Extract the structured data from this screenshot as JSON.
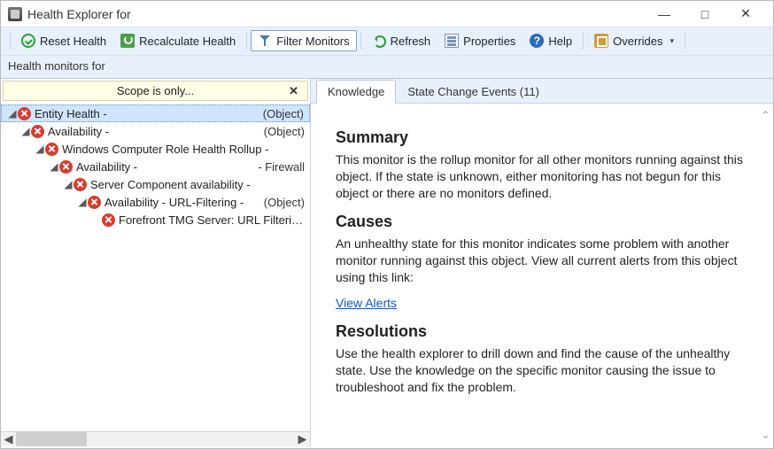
{
  "window": {
    "title": "Health Explorer for"
  },
  "toolbar": {
    "reset": "Reset Health",
    "recalc": "Recalculate Health",
    "filter": "Filter Monitors",
    "refresh": "Refresh",
    "properties": "Properties",
    "help": "Help",
    "overrides": "Overrides"
  },
  "subheader": "Health monitors for",
  "scope": {
    "text": "Scope is only..."
  },
  "tree": [
    {
      "indent": 0,
      "expander": "◢",
      "label": "Entity Health -",
      "kind": "(Object)",
      "selected": true
    },
    {
      "indent": 1,
      "expander": "◢",
      "label": "Availability -",
      "kind": "(Object)"
    },
    {
      "indent": 2,
      "expander": "◢",
      "label": "Windows Computer Role Health Rollup -",
      "kind": ""
    },
    {
      "indent": 3,
      "expander": "◢",
      "label": "Availability -",
      "kind": "- Firewall"
    },
    {
      "indent": 4,
      "expander": "◢",
      "label": "Server Component availability -",
      "kind": ""
    },
    {
      "indent": 5,
      "expander": "◢",
      "label": "Availability - URL-Filtering -",
      "kind": "(Object)"
    },
    {
      "indent": 6,
      "expander": "",
      "label": "Forefront TMG Server: URL Filtering - Server",
      "kind": ""
    }
  ],
  "tabs": {
    "knowledge": "Knowledge",
    "state_events": "State Change Events (11)",
    "active": "knowledge"
  },
  "knowledge": {
    "summary_h": "Summary",
    "summary_p": "This monitor is the rollup monitor for all other monitors running against this object. If the state is unknown, either monitoring has not begun for this object or there are no monitors defined.",
    "causes_h": "Causes",
    "causes_p": "An unhealthy state for this monitor indicates some problem with another monitor running against this object. View all current alerts from this object using this link:",
    "view_alerts": "View Alerts",
    "res_h": "Resolutions",
    "res_p": "Use the health explorer to drill down and find the cause of the unhealthy state. Use the knowledge on the specific monitor causing the issue to troubleshoot and fix the problem."
  }
}
